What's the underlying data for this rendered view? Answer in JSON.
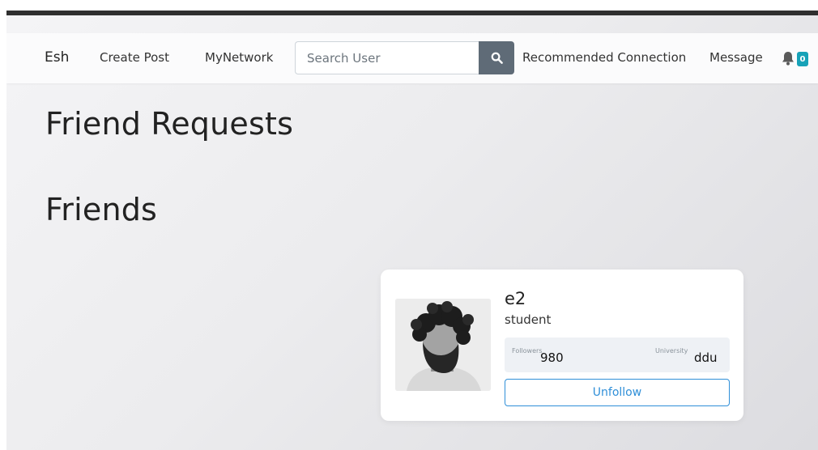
{
  "navbar": {
    "brand": "Esh",
    "create_post": "Create Post",
    "my_network": "MyNetwork",
    "search_placeholder": "Search User",
    "recommended": "Recommended Connection",
    "message": "Message",
    "notification_count": "0"
  },
  "headings": {
    "friend_requests": "Friend Requests",
    "friends": "Friends"
  },
  "friend_card": {
    "name": "e2",
    "role": "student",
    "followers_label": "Followers",
    "followers_value": "980",
    "university_label": "University",
    "university_value": "ddu",
    "unfollow_label": "Unfollow"
  },
  "colors": {
    "search_button": "#5f6b77",
    "badge": "#17a2b8",
    "unfollow_accent": "#2f8fd8"
  }
}
